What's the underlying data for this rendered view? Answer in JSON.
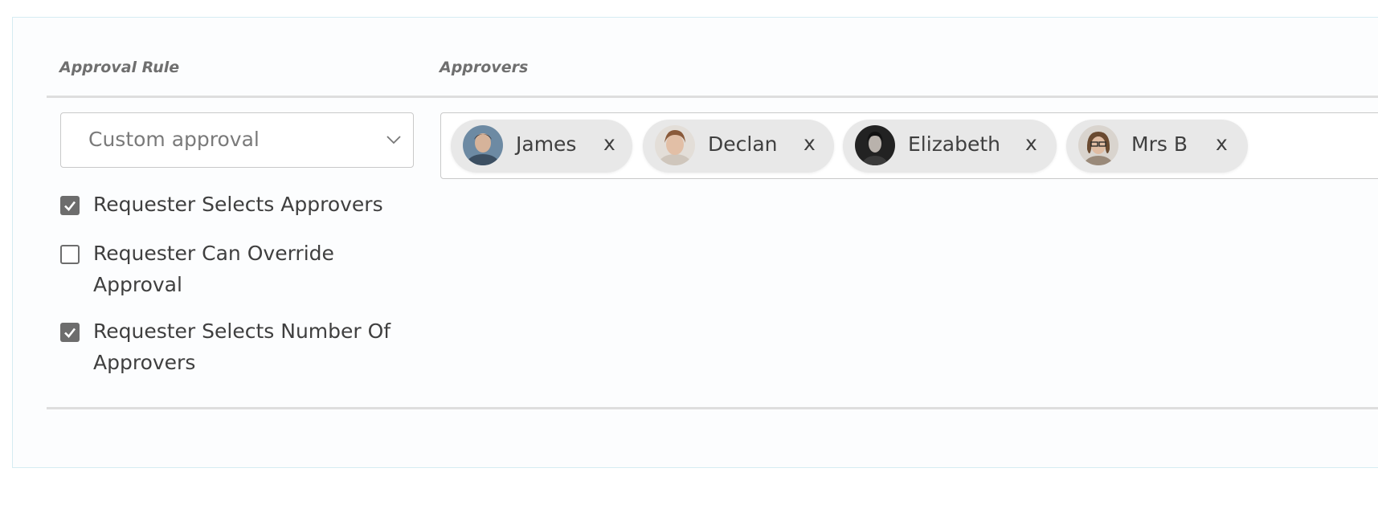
{
  "headers": {
    "approval_rule": "Approval Rule",
    "approvers": "Approvers"
  },
  "approval_rule_select": {
    "value": "Custom approval"
  },
  "options": [
    {
      "label": "Requester Selects Approvers",
      "checked": true
    },
    {
      "label": "Requester Can Override Approval",
      "checked": false
    },
    {
      "label": "Requester Selects Number Of Approvers",
      "checked": true
    }
  ],
  "approvers": [
    {
      "name": "James",
      "remove": "x"
    },
    {
      "name": "Declan",
      "remove": "x"
    },
    {
      "name": "Elizabeth",
      "remove": "x"
    },
    {
      "name": "Mrs B",
      "remove": "x"
    }
  ]
}
